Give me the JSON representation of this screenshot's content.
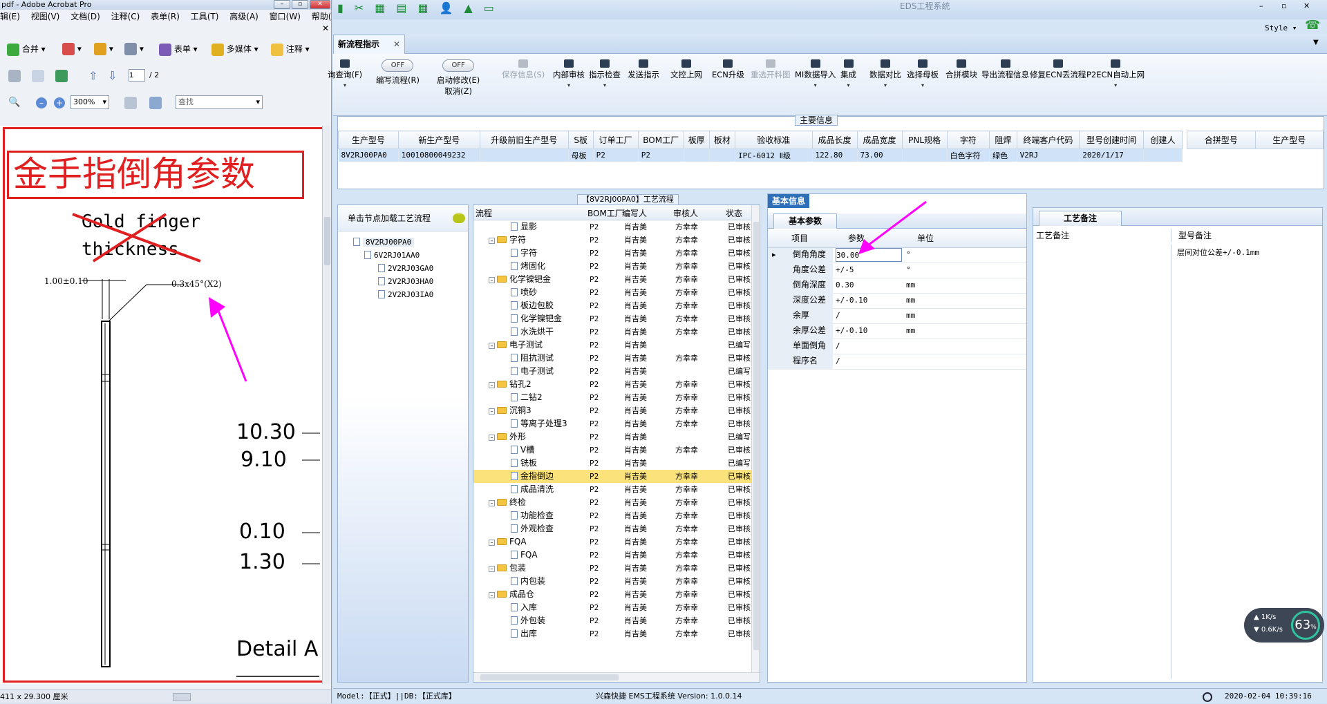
{
  "acrobat": {
    "title": "pdf - Adobe Acrobat Pro",
    "menu": [
      "辑(E)",
      "视图(V)",
      "文档(D)",
      "注释(C)",
      "表单(R)",
      "工具(T)",
      "高级(A)",
      "窗口(W)",
      "帮助(H)"
    ],
    "toolbar1": [
      "合并",
      "表单",
      "多媒体",
      "注释"
    ],
    "page_current": "1",
    "page_total": "/ 2",
    "zoom": "300%",
    "find_placeholder": "查找",
    "status": "411 x 29.300 厘米",
    "doc": {
      "heading": "金手指倒角参数",
      "crossed_line1": "Gold finger",
      "crossed_line2": "thickness",
      "dim_left": "1.00±0.10",
      "dim_chamfer": "0.3x45°(X2)",
      "values": [
        "10.30",
        "9.10",
        "0.10",
        "1.30"
      ],
      "detail": "Detail A"
    }
  },
  "eds": {
    "title": "EDS工程系统",
    "style_label": "Style",
    "tab": "新流程指示",
    "ribbon": [
      {
        "label": "询查询(F)",
        "kind": "btn"
      },
      {
        "label": "编写流程(R)",
        "kind": "toggle",
        "state": "OFF"
      },
      {
        "label": "启动修改(E)",
        "label2": "取消(Z)",
        "kind": "toggle",
        "state": "OFF"
      },
      {
        "label": "保存信息(S)",
        "kind": "dis"
      },
      {
        "label": "内部审核",
        "kind": "btn"
      },
      {
        "label": "指示检查",
        "kind": "btn"
      },
      {
        "label": "发送指示",
        "kind": "btn"
      },
      {
        "label": "文控上网",
        "kind": "btn"
      },
      {
        "label": "ECN升级",
        "kind": "btn"
      },
      {
        "label": "重选开料图",
        "kind": "dis"
      },
      {
        "label": "MI数据导入",
        "kind": "btn"
      },
      {
        "label": "集成",
        "kind": "btn"
      },
      {
        "label": "数据对比",
        "kind": "btn"
      },
      {
        "label": "选择母板",
        "kind": "btn"
      },
      {
        "label": "合拼模块",
        "kind": "btn"
      },
      {
        "label": "导出流程信息",
        "kind": "btn"
      },
      {
        "label": "修复ECN丢流程",
        "kind": "btn"
      },
      {
        "label": "P2ECN自动上网",
        "kind": "btn"
      }
    ],
    "main_info_title": "主要信息",
    "main_headers": [
      "生产型号",
      "新生产型号",
      "升级前旧生产型号",
      "S板",
      "订单工厂",
      "BOM工厂",
      "板厚",
      "板材",
      "验收标准",
      "成品长度",
      "成品宽度",
      "PNL规格",
      "字符",
      "阻焊",
      "终端客户代码",
      "型号创建时间",
      "创建人"
    ],
    "main_row": [
      "8V2RJ00PA0",
      "10010800049232",
      "",
      "母板",
      "P2",
      "P2",
      "",
      "",
      "IPC-6012 Ⅱ级",
      "122.80",
      "73.00",
      "",
      "白色字符",
      "绿色",
      "V2RJ",
      "2020/1/17",
      ""
    ],
    "merge_headers": [
      "合拼型号",
      "生产型号"
    ],
    "tree_title": "单击节点加载工艺流程",
    "tree": [
      "8V2RJ00PA0",
      "6V2RJ01AA0",
      "2V2RJ03GA0",
      "2V2RJ03HA0",
      "2V2RJ03IA0"
    ],
    "flow_title": "【8V2RJ00PA0】工艺流程",
    "flow_headers": [
      "流程",
      "BOM工厂",
      "编写人",
      "审核人",
      "状态"
    ],
    "flow_rows": [
      {
        "name": "显影",
        "lvl": 1,
        "bom": "P2",
        "w": "肖吉美",
        "r": "方幸幸",
        "s": "已审核"
      },
      {
        "name": "字符",
        "lvl": 0,
        "bom": "P2",
        "w": "肖吉美",
        "r": "方幸幸",
        "s": "已审核"
      },
      {
        "name": "字符",
        "lvl": 1,
        "bom": "P2",
        "w": "肖吉美",
        "r": "方幸幸",
        "s": "已审核"
      },
      {
        "name": "烤固化",
        "lvl": 1,
        "bom": "P2",
        "w": "肖吉美",
        "r": "方幸幸",
        "s": "已审核"
      },
      {
        "name": "化学镍钯金",
        "lvl": 0,
        "bom": "P2",
        "w": "肖吉美",
        "r": "方幸幸",
        "s": "已审核"
      },
      {
        "name": "喷砂",
        "lvl": 1,
        "bom": "P2",
        "w": "肖吉美",
        "r": "方幸幸",
        "s": "已审核"
      },
      {
        "name": "板边包胶",
        "lvl": 1,
        "bom": "P2",
        "w": "肖吉美",
        "r": "方幸幸",
        "s": "已审核"
      },
      {
        "name": "化学镍钯金",
        "lvl": 1,
        "bom": "P2",
        "w": "肖吉美",
        "r": "方幸幸",
        "s": "已审核"
      },
      {
        "name": "水洗烘干",
        "lvl": 1,
        "bom": "P2",
        "w": "肖吉美",
        "r": "方幸幸",
        "s": "已审核"
      },
      {
        "name": "电子测试",
        "lvl": 0,
        "bom": "P2",
        "w": "肖吉美",
        "r": "",
        "s": "已编写"
      },
      {
        "name": "阻抗测试",
        "lvl": 1,
        "bom": "P2",
        "w": "肖吉美",
        "r": "方幸幸",
        "s": "已审核"
      },
      {
        "name": "电子测试",
        "lvl": 1,
        "bom": "P2",
        "w": "肖吉美",
        "r": "",
        "s": "已编写"
      },
      {
        "name": "钻孔2",
        "lvl": 0,
        "bom": "P2",
        "w": "肖吉美",
        "r": "方幸幸",
        "s": "已审核"
      },
      {
        "name": "二钻2",
        "lvl": 1,
        "bom": "P2",
        "w": "肖吉美",
        "r": "方幸幸",
        "s": "已审核"
      },
      {
        "name": "沉铜3",
        "lvl": 0,
        "bom": "P2",
        "w": "肖吉美",
        "r": "方幸幸",
        "s": "已审核"
      },
      {
        "name": "等离子处理3",
        "lvl": 1,
        "bom": "P2",
        "w": "肖吉美",
        "r": "方幸幸",
        "s": "已审核"
      },
      {
        "name": "外形",
        "lvl": 0,
        "bom": "P2",
        "w": "肖吉美",
        "r": "",
        "s": "已编写"
      },
      {
        "name": "V槽",
        "lvl": 1,
        "bom": "P2",
        "w": "肖吉美",
        "r": "方幸幸",
        "s": "已审核"
      },
      {
        "name": "铣板",
        "lvl": 1,
        "bom": "P2",
        "w": "肖吉美",
        "r": "",
        "s": "已编写"
      },
      {
        "name": "金指倒边",
        "lvl": 1,
        "bom": "P2",
        "w": "肖吉美",
        "r": "方幸幸",
        "s": "已审核",
        "sel": true
      },
      {
        "name": "成品清洗",
        "lvl": 1,
        "bom": "P2",
        "w": "肖吉美",
        "r": "方幸幸",
        "s": "已审核"
      },
      {
        "name": "终检",
        "lvl": 0,
        "bom": "P2",
        "w": "肖吉美",
        "r": "方幸幸",
        "s": "已审核"
      },
      {
        "name": "功能检查",
        "lvl": 1,
        "bom": "P2",
        "w": "肖吉美",
        "r": "方幸幸",
        "s": "已审核"
      },
      {
        "name": "外观检查",
        "lvl": 1,
        "bom": "P2",
        "w": "肖吉美",
        "r": "方幸幸",
        "s": "已审核"
      },
      {
        "name": "FQA",
        "lvl": 0,
        "bom": "P2",
        "w": "肖吉美",
        "r": "方幸幸",
        "s": "已审核"
      },
      {
        "name": "FQA",
        "lvl": 1,
        "bom": "P2",
        "w": "肖吉美",
        "r": "方幸幸",
        "s": "已审核"
      },
      {
        "name": "包装",
        "lvl": 0,
        "bom": "P2",
        "w": "肖吉美",
        "r": "方幸幸",
        "s": "已审核"
      },
      {
        "name": "内包装",
        "lvl": 1,
        "bom": "P2",
        "w": "肖吉美",
        "r": "方幸幸",
        "s": "已审核"
      },
      {
        "name": "成品仓",
        "lvl": 0,
        "bom": "P2",
        "w": "肖吉美",
        "r": "方幸幸",
        "s": "已审核"
      },
      {
        "name": "入库",
        "lvl": 1,
        "bom": "P2",
        "w": "肖吉美",
        "r": "方幸幸",
        "s": "已审核"
      },
      {
        "name": "外包装",
        "lvl": 1,
        "bom": "P2",
        "w": "肖吉美",
        "r": "方幸幸",
        "s": "已审核"
      },
      {
        "name": "出库",
        "lvl": 1,
        "bom": "P2",
        "w": "肖吉美",
        "r": "方幸幸",
        "s": "已审核"
      }
    ],
    "basic_info_tab": "基本信息",
    "basic_params_tab": "基本参数",
    "param_headers": [
      "项目",
      "参数",
      "单位"
    ],
    "params": [
      {
        "item": "倒角角度",
        "val": "30.00",
        "unit": "°"
      },
      {
        "item": "角度公差",
        "val": "+/-5",
        "unit": "°"
      },
      {
        "item": "倒角深度",
        "val": "0.30",
        "unit": "mm"
      },
      {
        "item": "深度公差",
        "val": "+/-0.10",
        "unit": "mm"
      },
      {
        "item": "余厚",
        "val": "/",
        "unit": "mm"
      },
      {
        "item": "余厚公差",
        "val": "+/-0.10",
        "unit": "mm"
      },
      {
        "item": "单面倒角",
        "val": "/",
        "unit": ""
      },
      {
        "item": "程序名",
        "val": "/",
        "unit": ""
      }
    ],
    "process_note_tab": "工艺备注",
    "note_headers": [
      "工艺备注",
      "型号备注"
    ],
    "model_note": "层间对位公差+/-0.1mm",
    "status_left": "Model:【正式】||DB:【正式库】",
    "status_center": "兴森快捷 EMS工程系统 Version: 1.0.0.14",
    "status_time": "2020-02-04 10:39:16",
    "net_up": "1K/s",
    "net_down": "0.6K/s",
    "net_pct": "63"
  }
}
